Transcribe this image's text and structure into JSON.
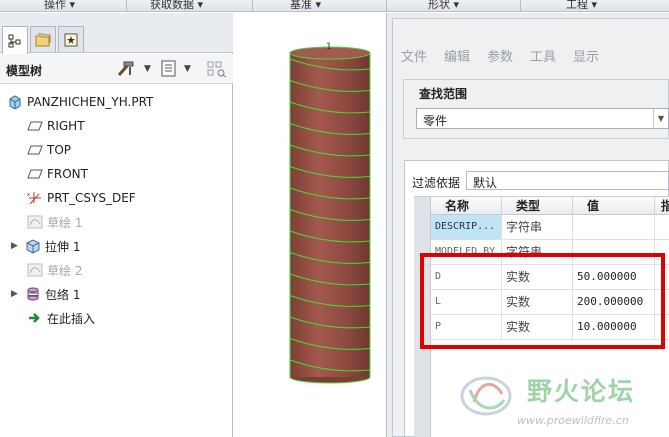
{
  "ribbon": {
    "groups": [
      "操作 ▾",
      "获取数据 ▾",
      "基准 ▾",
      "形状 ▾",
      "工程 ▾"
    ]
  },
  "model_tree": {
    "title": "模型树",
    "items": [
      {
        "label": "PANZHICHEN_YH.PRT",
        "icon": "part-icon",
        "dim": false,
        "expandable": false
      },
      {
        "label": "RIGHT",
        "icon": "datum-plane-icon",
        "dim": false,
        "expandable": false
      },
      {
        "label": "TOP",
        "icon": "datum-plane-icon",
        "dim": false,
        "expandable": false
      },
      {
        "label": "FRONT",
        "icon": "datum-plane-icon",
        "dim": false,
        "expandable": false
      },
      {
        "label": "PRT_CSYS_DEF",
        "icon": "csys-icon",
        "dim": false,
        "expandable": false
      },
      {
        "label": "草绘 1",
        "icon": "sketch-icon",
        "dim": true,
        "expandable": false
      },
      {
        "label": "拉伸 1",
        "icon": "extrude-icon",
        "dim": false,
        "expandable": true
      },
      {
        "label": "草绘 2",
        "icon": "sketch-icon",
        "dim": true,
        "expandable": false
      },
      {
        "label": "包络 1",
        "icon": "wrap-icon",
        "dim": false,
        "expandable": true
      },
      {
        "label": "在此插入",
        "icon": "insert-arrow-icon",
        "dim": false,
        "expandable": false
      }
    ]
  },
  "graphics": {
    "cylinder_color": "#9a4f45",
    "helix_color": "#44dd33"
  },
  "parameters_dialog": {
    "menu": [
      "文件",
      "编辑",
      "参数",
      "工具",
      "显示"
    ],
    "search_scope_label": "查找范围",
    "search_scope_value": "零件",
    "filter_label": "过滤依据",
    "filter_value": "默认",
    "columns": [
      "名称",
      "类型",
      "值",
      "指"
    ],
    "rows": [
      {
        "name": "DESCRIP...",
        "type": "字符串",
        "value": "",
        "selected": true
      },
      {
        "name": "MODELED_BY",
        "type": "字符串",
        "value": "",
        "selected": false
      },
      {
        "name": "D",
        "type": "实数",
        "value": "50.000000",
        "selected": false
      },
      {
        "name": "L",
        "type": "实数",
        "value": "200.000000",
        "selected": false
      },
      {
        "name": "P",
        "type": "实数",
        "value": "10.000000",
        "selected": false
      }
    ],
    "highlight_color": "#e00000"
  },
  "watermark": {
    "text": "野火论坛",
    "url": "www.proewildfire.cn"
  }
}
